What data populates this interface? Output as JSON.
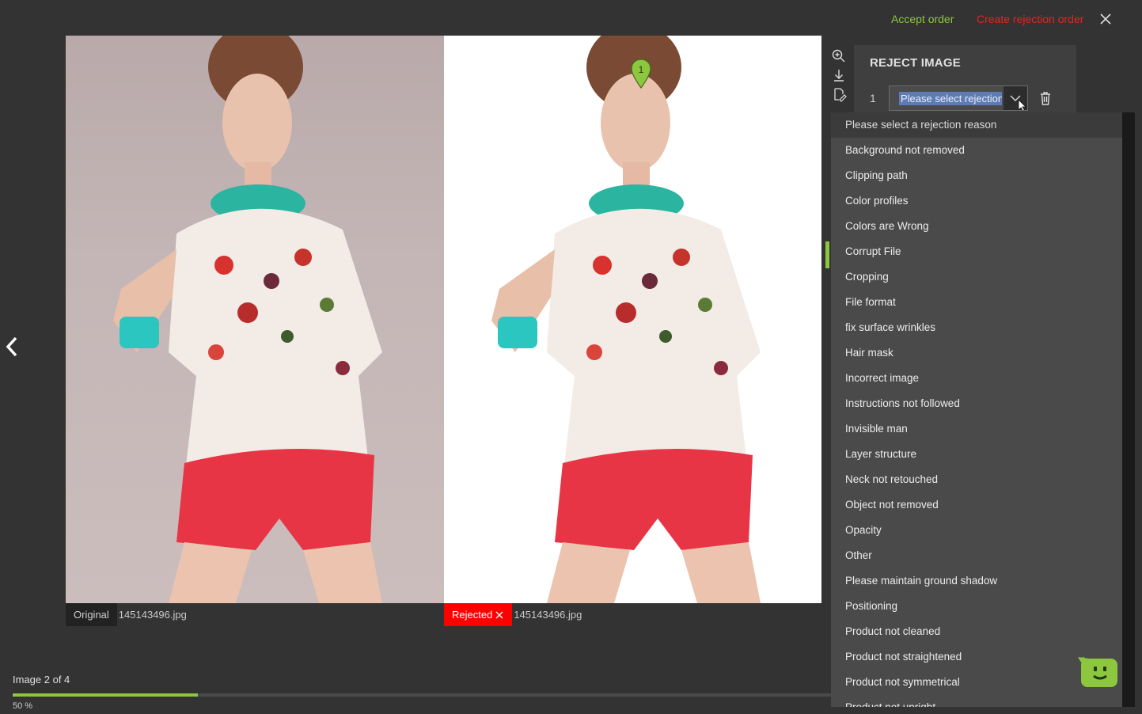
{
  "topbar": {
    "accept_label": "Accept order",
    "create_rejection_label": "Create rejection order"
  },
  "colors": {
    "accent_green": "#8dc63f",
    "reject_red": "#e8231f",
    "background": "#333333"
  },
  "icons": {
    "close": "close-icon",
    "prev": "chevron-left-icon",
    "zoom": "zoom-in-icon",
    "download": "download-icon",
    "annotate": "annotate-icon",
    "delete": "trash-icon",
    "bot": "chatbot-icon",
    "marker": "map-pin-icon"
  },
  "images": {
    "original": {
      "tag": "Original",
      "filename": "145143496.jpg"
    },
    "rejected": {
      "tag": "Rejected",
      "filename": "145143496.jpg",
      "marker_number": "1"
    }
  },
  "reject_panel": {
    "title": "REJECT IMAGE",
    "row_number": "1",
    "select_value": "Please select rejection reason"
  },
  "dropdown": {
    "options": [
      "Please select a rejection reason",
      "Background not removed",
      "Clipping path",
      "Color profiles",
      "Colors are Wrong",
      "Corrupt File",
      "Cropping",
      "File format",
      "fix surface wrinkles",
      "Hair mask",
      "Incorrect image",
      "Instructions not followed",
      "Invisible man",
      "Layer structure",
      "Neck not retouched",
      "Object not removed",
      "Opacity",
      "Other",
      "Please maintain ground shadow",
      "Positioning",
      "Product not cleaned",
      "Product not straightened",
      "Product not symmetrical",
      "Product not upright"
    ]
  },
  "footer": {
    "pager_text": "Image 2 of 4",
    "progress_label": "50 %",
    "progress_fraction": 0.5
  }
}
